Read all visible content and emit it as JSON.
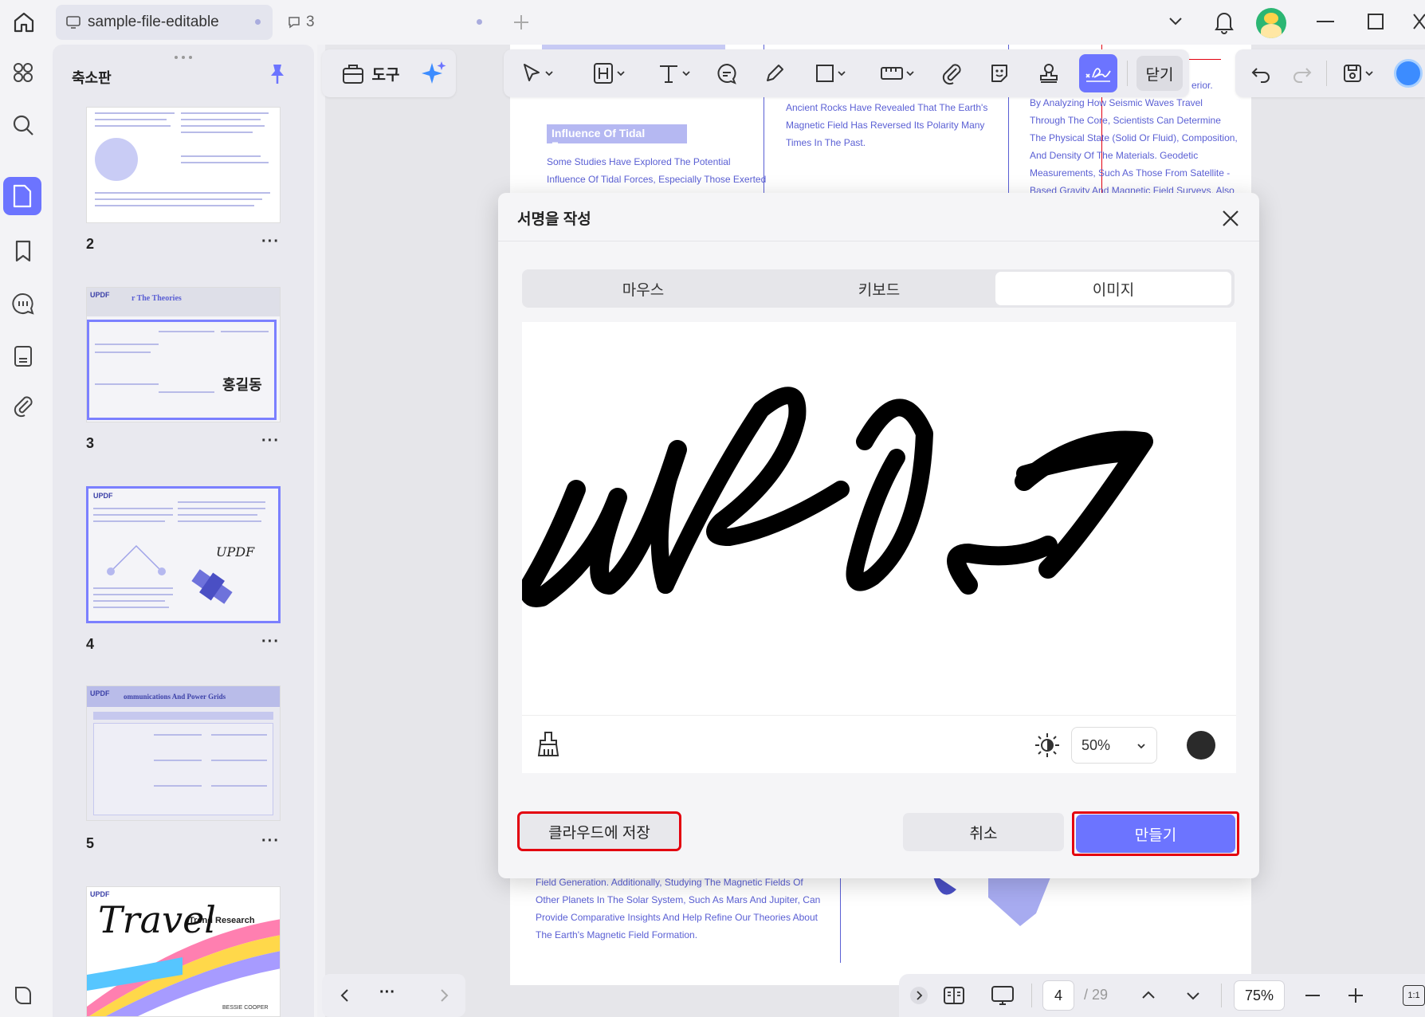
{
  "tabs": [
    {
      "label": "sample-file-editable"
    },
    {
      "label": "3"
    }
  ],
  "panel": {
    "title": "축소판",
    "pages": [
      "2",
      "3",
      "4",
      "5"
    ],
    "more": "···"
  },
  "thumb3": {
    "brand": "UPDF",
    "title": "r The Theories",
    "handwriting": "홍길동"
  },
  "thumb4": {
    "brand": "UPDF",
    "sig": "UPDF"
  },
  "thumb5": {
    "brand": "UPDF",
    "title": "ommunications And Power Grids"
  },
  "thumb6": {
    "brand": "UPDF",
    "title": "Trend Research",
    "script": "Travel",
    "author": "BESSIE COOPER"
  },
  "toolbar": {
    "tools_label": "도구",
    "close_label": "닫기"
  },
  "doc": {
    "heading": "Influence Of Tidal Forces",
    "col1": [
      "Some Studies Have Explored The Potential",
      "Influence Of Tidal Forces, Especially Those Exerted"
    ],
    "col2": [
      "Ancient Rocks Have Revealed That The Earth's",
      "Magnetic Field Has Reversed Its Polarity Many",
      "Times In The Past."
    ],
    "col3": [
      "By Analyzing How Seismic Waves Travel",
      "Through The Core, Scientists Can Determine",
      "The Physical State (Solid Or Fluid), Composition,",
      "And Density Of The Materials. Geodetic",
      "Measurements, Such As Those From Satellite -",
      "Based Gravity And Magnetic Field Surveys, Also"
    ],
    "col3_top": "erior.",
    "bottom": [
      "Field Generation. Additionally, Studying The Magnetic Fields Of",
      "Other Planets In The Solar System, Such As Mars And Jupiter, Can",
      "Provide Comparative Insights And Help Refine Our Theories About",
      "The Earth's Magnetic Field Formation."
    ]
  },
  "dialog": {
    "title": "서명을 작성",
    "modes": [
      "마우스",
      "키보드",
      "이미지"
    ],
    "active_mode": "이미지",
    "opacity": "50%",
    "ink_color": "#2a2a2a",
    "save_cloud": "클라우드에 저장",
    "cancel": "취소",
    "create": "만들기"
  },
  "pager": {
    "current": "4",
    "total": "/ 29",
    "zoom": "75%",
    "fit": "1:1"
  },
  "colors": {
    "accent": "#6c74ff",
    "text_blue": "#5a5fd4",
    "highlight": "#e3000f"
  }
}
